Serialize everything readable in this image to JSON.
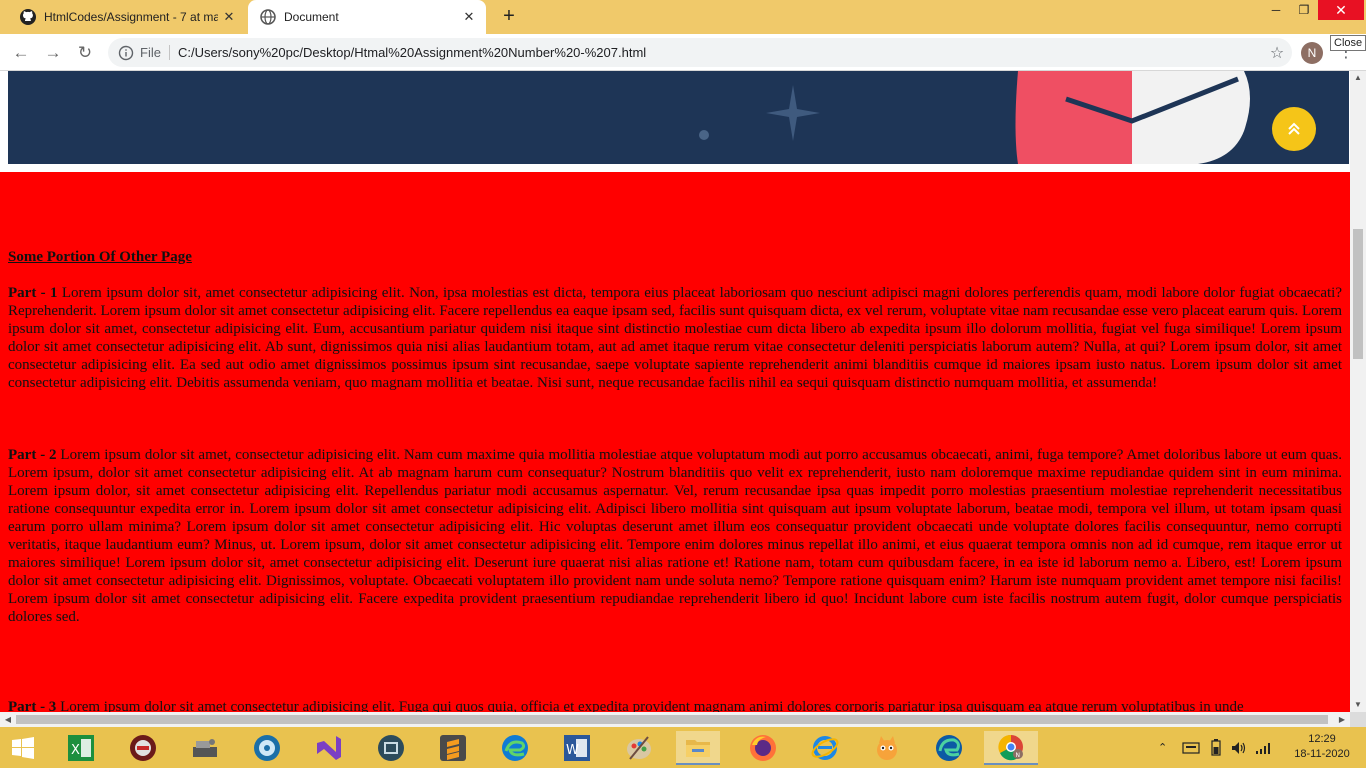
{
  "browser": {
    "tabs": [
      {
        "title": "HtmlCodes/Assignment - 7 at ma",
        "active": false
      },
      {
        "title": "Document",
        "active": true
      }
    ],
    "tooltip": "Close",
    "address": {
      "scheme_label": "File",
      "url": "C:/Users/sony%20pc/Desktop/Htmal%20Assignment%20Number%20-%207.html"
    },
    "profile_initial": "N"
  },
  "page": {
    "heading": "Some Portion Of Other Page",
    "parts": [
      {
        "label": "Part - 1",
        "text": " Lorem ipsum dolor sit, amet consectetur adipisicing elit. Non, ipsa molestias est dicta, tempora eius placeat laboriosam quo nesciunt adipisci magni dolores perferendis quam, modi labore dolor fugiat obcaecati? Reprehenderit. Lorem ipsum dolor sit amet consectetur adipisicing elit. Facere repellendus ea eaque ipsam sed, facilis sunt quisquam dicta, ex vel rerum, voluptate vitae nam recusandae esse vero placeat earum quis. Lorem ipsum dolor sit amet, consectetur adipisicing elit. Eum, accusantium pariatur quidem nisi itaque sint distinctio molestiae cum dicta libero ab expedita ipsum illo dolorum mollitia, fugiat vel fuga similique! Lorem ipsum dolor sit amet consectetur adipisicing elit. Ab sunt, dignissimos quia nisi alias laudantium totam, aut ad amet itaque rerum vitae consectetur deleniti perspiciatis laborum autem? Nulla, at qui? Lorem ipsum dolor, sit amet consectetur adipisicing elit. Ea sed aut odio amet dignissimos possimus ipsum sint recusandae, saepe voluptate sapiente reprehenderit animi blanditiis cumque id maiores ipsam iusto natus. Lorem ipsum dolor sit amet consectetur adipisicing elit. Debitis assumenda veniam, quo magnam mollitia et beatae. Nisi sunt, neque recusandae facilis nihil ea sequi quisquam distinctio numquam mollitia, et assumenda!"
      },
      {
        "label": "Part - 2",
        "text": " Lorem ipsum dolor sit amet, consectetur adipisicing elit. Nam cum maxime quia mollitia molestiae atque voluptatum modi aut porro accusamus obcaecati, animi, fuga tempore? Amet doloribus labore ut eum quas. Lorem ipsum, dolor sit amet consectetur adipisicing elit. At ab magnam harum cum consequatur? Nostrum blanditiis quo velit ex reprehenderit, iusto nam doloremque maxime repudiandae quidem sint in eum minima. Lorem ipsum dolor, sit amet consectetur adipisicing elit. Repellendus pariatur modi accusamus aspernatur. Vel, rerum recusandae ipsa quas impedit porro molestias praesentium molestiae reprehenderit necessitatibus ratione consequuntur expedita error in. Lorem ipsum dolor sit amet consectetur adipisicing elit. Adipisci libero mollitia sint quisquam aut ipsum voluptate laborum, beatae modi, tempora vel illum, ut totam ipsam quasi earum porro ullam minima? Lorem ipsum dolor sit amet consectetur adipisicing elit. Hic voluptas deserunt amet illum eos consequatur provident obcaecati unde voluptate dolores facilis consequuntur, nemo corrupti veritatis, itaque laudantium eum? Minus, ut. Lorem ipsum, dolor sit amet consectetur adipisicing elit. Tempore enim dolores minus repellat illo animi, et eius quaerat tempora omnis non ad id cumque, rem itaque error ut maiores similique! Lorem ipsum dolor sit, amet consectetur adipisicing elit. Deserunt iure quaerat nisi alias ratione et! Ratione nam, totam cum quibusdam facere, in ea iste id laborum nemo a. Libero, est! Lorem ipsum dolor sit amet consectetur adipisicing elit. Dignissimos, voluptate. Obcaecati voluptatem illo provident nam unde soluta nemo? Tempore ratione quisquam enim? Harum iste numquam provident amet tempore nisi facilis! Lorem ipsum dolor sit amet consectetur adipisicing elit. Facere expedita provident praesentium repudiandae reprehenderit libero id quo! Incidunt labore cum iste facilis nostrum autem fugit, dolor cumque perspiciatis dolores sed."
      },
      {
        "label": "Part - 3",
        "text": " Lorem ipsum dolor sit amet consectetur adipisicing elit. Fuga qui quos quia, officia et expedita provident magnam animi dolores corporis pariatur ipsa quisquam ea atque rerum voluptatibus in unde"
      }
    ]
  },
  "taskbar": {
    "apps": [
      "start",
      "excel",
      "media-player",
      "scanner",
      "disc",
      "visual-studio",
      "video",
      "sublime",
      "edge",
      "word",
      "paint",
      "file-explorer",
      "firefox",
      "internet-explorer",
      "scratch",
      "edge-new",
      "chrome"
    ],
    "time": "12:29",
    "date": "18-11-2020"
  },
  "colors": {
    "tab_bar": "#f0c96a",
    "hero_navy": "#1e3556",
    "content_red": "#ff0000",
    "scroll_button": "#f5c518",
    "taskbar": "#e9c24f"
  }
}
